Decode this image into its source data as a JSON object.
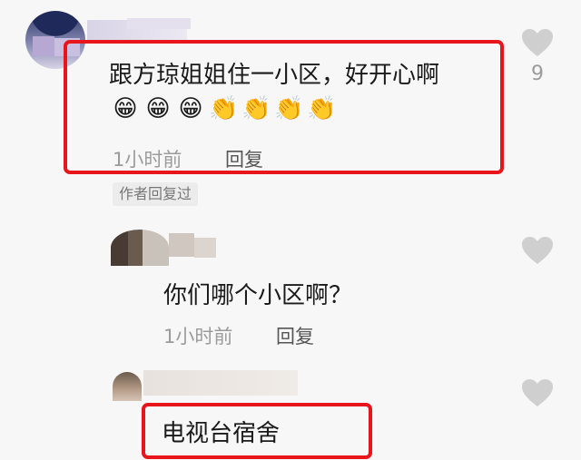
{
  "comments": [
    {
      "text": "跟方琼姐姐住一小区，好开心啊",
      "emojis": [
        "😁",
        "😁",
        "😁",
        "👏",
        "👏",
        "👏",
        "👏"
      ],
      "time": "1小时前",
      "reply_label": "回复",
      "like_count": "9",
      "badge": "作者回复过"
    },
    {
      "text": "你们哪个小区啊？",
      "time": "1小时前",
      "reply_label": "回复"
    },
    {
      "text": "电视台宿舍"
    }
  ],
  "colors": {
    "highlight": "#e8151b",
    "meta_gray": "#9b9b9b",
    "background": "#f7f7f7"
  },
  "icons": {
    "like": "heart-outline-icon"
  }
}
